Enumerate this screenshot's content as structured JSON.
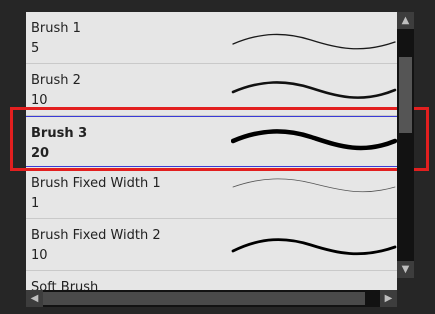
{
  "brushes": [
    {
      "name": "Brush 1",
      "size": "5",
      "stroke": "thin"
    },
    {
      "name": "Brush 2",
      "size": "10",
      "stroke": "medium"
    },
    {
      "name": "Brush 3",
      "size": "20",
      "stroke": "thick",
      "selected": true
    },
    {
      "name": "Brush Fixed Width 1",
      "size": "1",
      "stroke": "hairline"
    },
    {
      "name": "Brush Fixed Width 2",
      "size": "10",
      "stroke": "fixed-medium"
    },
    {
      "name": "Soft Brush",
      "size": "",
      "stroke": "soft"
    }
  ],
  "colors": {
    "selection_highlight": "#e21f1f",
    "selection_border": "#3b3bd6",
    "list_background": "#e6e6e6"
  },
  "icons": {
    "scroll_up": "▲",
    "scroll_down": "▼",
    "scroll_left": "◀",
    "scroll_right": "▶"
  }
}
